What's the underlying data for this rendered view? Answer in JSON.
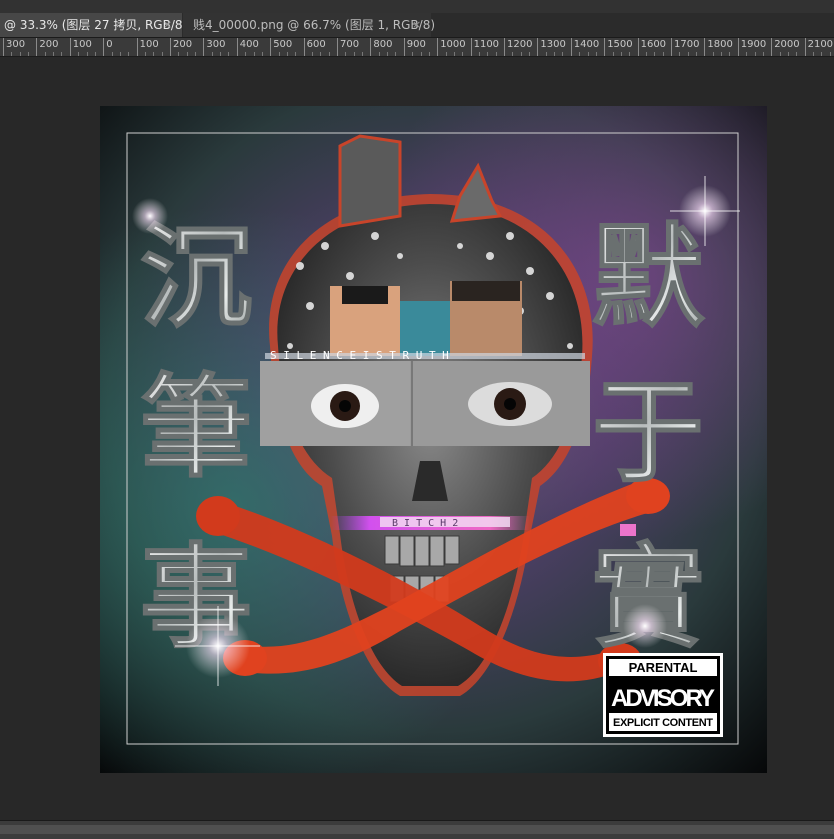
{
  "tabs": [
    {
      "label": "@ 33.3% (图层 27 拷贝, RGB/8)",
      "close": "×",
      "active": true
    },
    {
      "label": "贱4_00000.png @ 66.7% (图层 1, RGB/8)",
      "close": "×",
      "active": false
    }
  ],
  "ruler": {
    "labels": [
      "300",
      "200",
      "100",
      "0",
      "100",
      "200",
      "300",
      "400",
      "500",
      "600",
      "700",
      "800",
      "900",
      "1000",
      "1100",
      "1200",
      "1300",
      "1400",
      "1500",
      "1600",
      "1700",
      "1800",
      "1900",
      "2000",
      "2100"
    ]
  },
  "artwork": {
    "left_chars": [
      "沉",
      "筆",
      "事"
    ],
    "right_chars": [
      "默",
      "于",
      "實"
    ],
    "strip_text": "S I L E N C E  I S  T R U T H",
    "bitch_label": "B I T C H 2",
    "advisory": {
      "line1": "PARENTAL",
      "line2": "ADVISORY",
      "line3": "EXPLICIT CONTENT"
    }
  },
  "colors": {
    "workspace": "#282828",
    "tab_active": "#474747",
    "ruler": "#3a3a3a",
    "cross_red": "#d23a1c",
    "glow_pink": "#e040ff"
  }
}
